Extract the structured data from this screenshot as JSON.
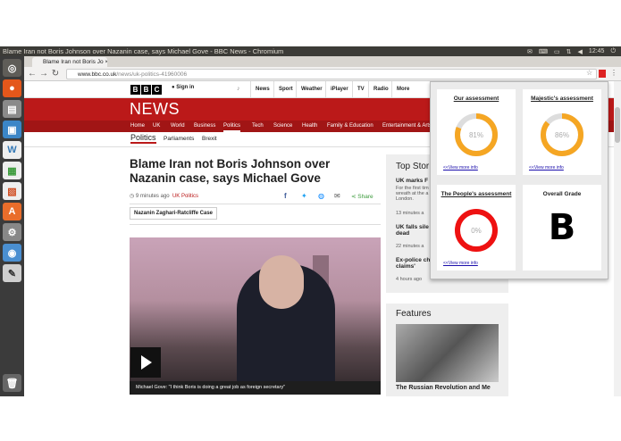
{
  "window": {
    "title": "Blame Iran not Boris Johnson over Nazanin case, says Michael Gove - BBC News - Chromium",
    "clock": "12:45"
  },
  "browser": {
    "tab_title": "Blame Iran not Boris Jo",
    "url_host": "www.bbc.co.uk",
    "url_path": "/news/uk-politics-41960006"
  },
  "bbc": {
    "logo": [
      "B",
      "B",
      "C"
    ],
    "sign_in": "Sign in",
    "nav": [
      "News",
      "Sport",
      "Weather",
      "iPlayer",
      "TV",
      "Radio",
      "More"
    ],
    "news_title": "NEWS",
    "subnav": [
      "Home",
      "UK",
      "World",
      "Business",
      "Politics",
      "Tech",
      "Science",
      "Health",
      "Family & Education",
      "Entertainment & Arts"
    ],
    "politics_nav": [
      "Politics",
      "Parliaments",
      "Brexit"
    ]
  },
  "article": {
    "headline": "Blame Iran not Boris Johnson over Nazanin case, says Michael Gove",
    "time": "9 minutes ago",
    "section": "UK Politics",
    "share": "Share",
    "tag": "Nazanin Zaghari-Ratcliffe Case",
    "caption": "Michael Gove: \"I think Boris is doing a great job as foreign secretary\""
  },
  "sidebar": {
    "top_stories": "Top Stor",
    "items": [
      {
        "title": "UK marks F",
        "desc": "For the first tim wreath at the a London.",
        "time": "13 minutes a"
      },
      {
        "title": "UK falls sile dead",
        "time": "22 minutes a"
      },
      {
        "title": "Ex-police ch claims'",
        "time": "4 hours ago"
      }
    ],
    "features": "Features",
    "feature_title": "The Russian Revolution and Me"
  },
  "popup": {
    "cards": [
      {
        "title": "Our assessment",
        "value": "81%",
        "pct": 81,
        "color": "#f5a623",
        "more": "<<View more info"
      },
      {
        "title": "Majestic's assessment",
        "value": "86%",
        "pct": 86,
        "color": "#f5a623",
        "more": "<<View more info"
      },
      {
        "title": "The People's assessment",
        "value": "0%",
        "pct": 0,
        "color": "#ee1111",
        "more": "<<View more info"
      },
      {
        "title": "Overall Grade",
        "grade": "B"
      }
    ]
  }
}
